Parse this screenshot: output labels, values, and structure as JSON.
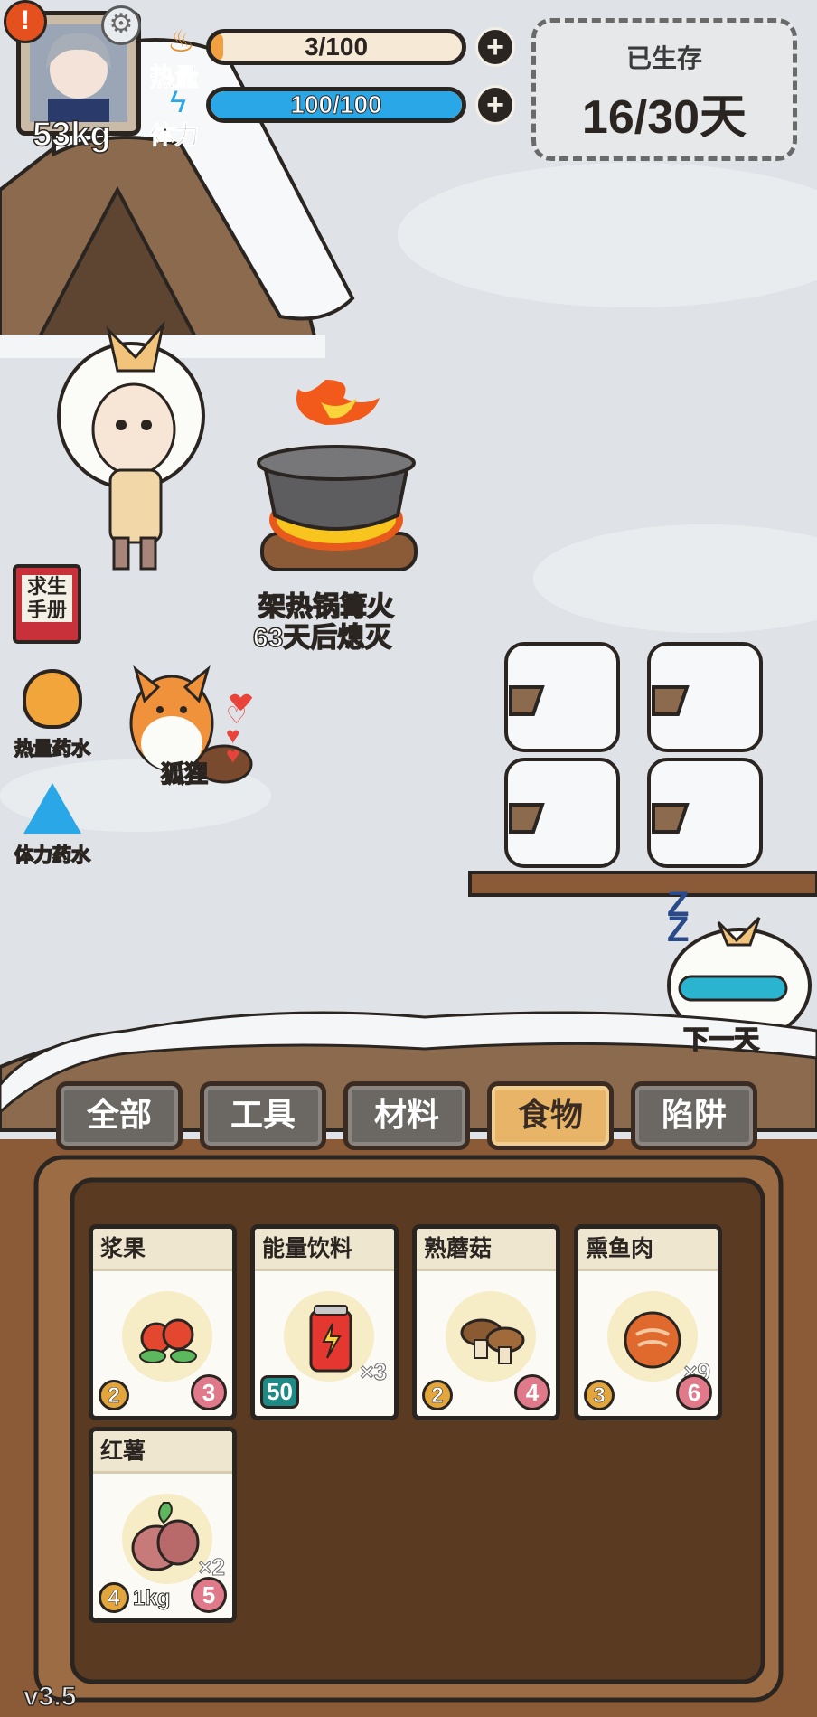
{
  "hud": {
    "weight": "53kg",
    "heat_label": "热量",
    "stamina_label": "体力",
    "heat_value": "3/100",
    "heat_fraction": 0.03,
    "stamina_value": "100/100",
    "stamina_fraction": 1.0,
    "survived_label": "已生存",
    "survived_days": "16/30天"
  },
  "scene": {
    "campfire_name": "架热锅篝火",
    "campfire_timer": "63天后熄灭",
    "pet_name": "狐狸",
    "next_day_label": "下一天"
  },
  "side_menu": {
    "manual_label": "求生\n手册",
    "heat_potion_label": "热量药水",
    "stamina_potion_label": "体力药水"
  },
  "tabs": [
    "全部",
    "工具",
    "材料",
    "食物",
    "陷阱"
  ],
  "active_tab": "食物",
  "items": [
    {
      "name": "浆果",
      "left_value": "2",
      "right_value": "3",
      "qty": "",
      "icon": "berries-icon"
    },
    {
      "name": "能量饮料",
      "left_value": "50",
      "right_value": "",
      "qty": "×3",
      "icon": "energy-drink-icon"
    },
    {
      "name": "熟蘑菇",
      "left_value": "2",
      "right_value": "4",
      "qty": "",
      "icon": "mushroom-icon"
    },
    {
      "name": "熏鱼肉",
      "left_value": "3",
      "right_value": "6",
      "qty": "×9",
      "icon": "smoked-fish-icon"
    },
    {
      "name": "红薯",
      "left_value": "4",
      "weight": "1kg",
      "right_value": "5",
      "qty": "×2",
      "icon": "sweet-potato-icon"
    }
  ],
  "version": "v3.5",
  "colors": {
    "stamina_fill": "#2aa7e6",
    "active_tab": "#e8b467",
    "panel_wood": "#5b3a22",
    "snow": "#f4f6f8"
  }
}
